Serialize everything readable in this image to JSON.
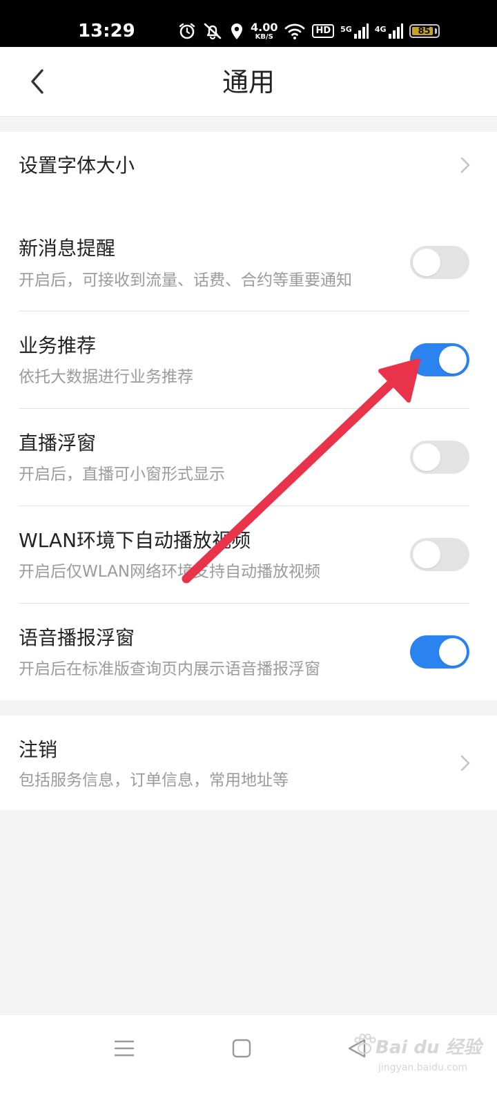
{
  "status_bar": {
    "time": "13:29",
    "icons": [
      "alarm-icon",
      "mute-icon",
      "location-icon",
      "wifi-icon",
      "hd-icon",
      "signal-5g-icon",
      "signal-4g-icon",
      "battery-icon"
    ],
    "speed_value": "4.00",
    "speed_unit": "KB/S",
    "hd_label": "HD",
    "net1_label": "5G",
    "net2_label": "4G",
    "battery_level": 85,
    "battery_text": "85"
  },
  "header": {
    "title": "通用",
    "back_icon": "chevron-left-icon"
  },
  "settings": {
    "font_size": {
      "title": "设置字体大小"
    },
    "new_message": {
      "title": "新消息提醒",
      "subtitle": "开启后，可接收到流量、话费、合约等重要通知",
      "enabled": false
    },
    "business": {
      "title": "业务推荐",
      "subtitle": "依托大数据进行业务推荐",
      "enabled": true
    },
    "live_float": {
      "title": "直播浮窗",
      "subtitle": "开启后，直播可小窗形式显示",
      "enabled": false
    },
    "wlan_autoplay": {
      "title": "WLAN环境下自动播放视频",
      "subtitle": "开启后仅WLAN网络环境支持自动播放视频",
      "enabled": false
    },
    "voice_float": {
      "title": "语音播报浮窗",
      "subtitle": "开启后在标准版查询页内展示语音播报浮窗",
      "enabled": true
    },
    "logout": {
      "title": "注销",
      "subtitle": "包括服务信息，订单信息，常用地址等"
    }
  },
  "colors": {
    "toggle_on": "#2b83f0",
    "toggle_off": "#e3e3e3",
    "arrow": "#e8334a",
    "page_bg": "#f4f4f4"
  },
  "nav_bar": {
    "icons": [
      "menu-icon",
      "home-square-icon",
      "back-triangle-icon"
    ]
  },
  "watermark": {
    "main": "Bai du 经验",
    "sub": "jingyan.baidu.com"
  }
}
